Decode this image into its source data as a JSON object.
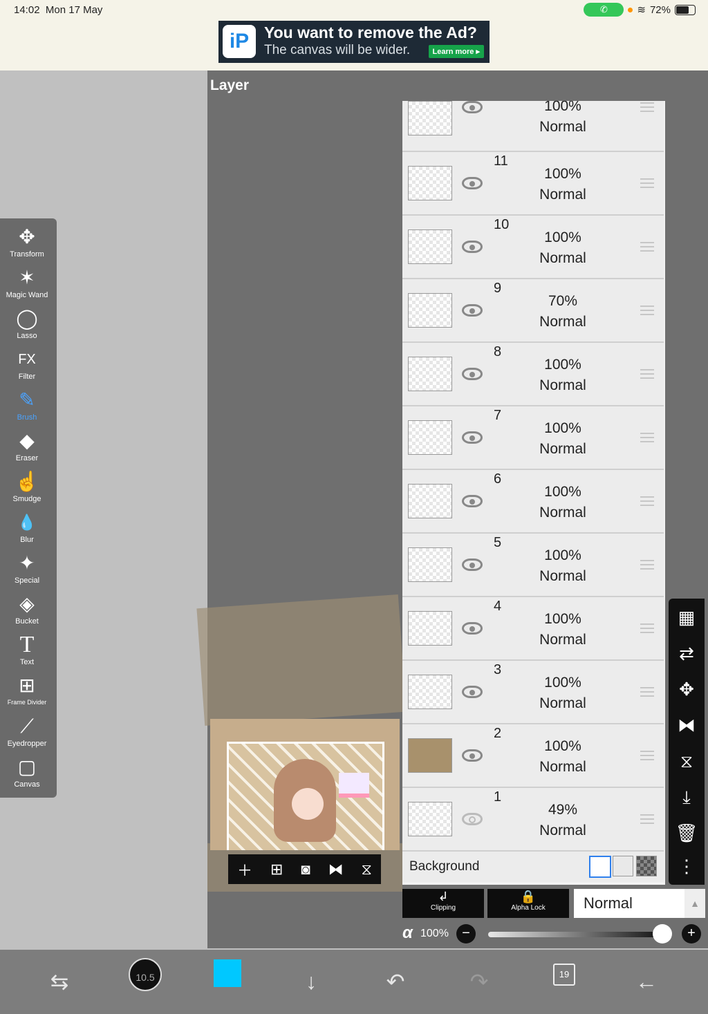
{
  "status": {
    "time": "14:02",
    "date": "Mon 17 May",
    "battery": "72%",
    "call_icon": "phone-icon"
  },
  "ad": {
    "title": "You want to remove the Ad?",
    "subtitle": "The canvas will be wider.",
    "button": "Learn more ▸",
    "logo": "iP"
  },
  "panel": {
    "title": "Layer"
  },
  "tools": [
    {
      "label": "Transform",
      "icon": "✥"
    },
    {
      "label": "Magic Wand",
      "icon": "✶"
    },
    {
      "label": "Lasso",
      "icon": "◯"
    },
    {
      "label": "Filter",
      "icon": "FX"
    },
    {
      "label": "Brush",
      "icon": "✎"
    },
    {
      "label": "Eraser",
      "icon": "◆"
    },
    {
      "label": "Smudge",
      "icon": "☝"
    },
    {
      "label": "Blur",
      "icon": "💧"
    },
    {
      "label": "Special",
      "icon": "✦"
    },
    {
      "label": "Bucket",
      "icon": "◈"
    },
    {
      "label": "Text",
      "icon": "T"
    },
    {
      "label": "Frame Divider",
      "icon": "⊞"
    },
    {
      "label": "Eyedropper",
      "icon": "⟋"
    },
    {
      "label": "Canvas",
      "icon": "▢"
    }
  ],
  "active_tool": "Brush",
  "layers": [
    {
      "num": "",
      "opacity": "100%",
      "blend": "Normal",
      "visible": true
    },
    {
      "num": "11",
      "opacity": "100%",
      "blend": "Normal",
      "visible": true
    },
    {
      "num": "10",
      "opacity": "100%",
      "blend": "Normal",
      "visible": true
    },
    {
      "num": "9",
      "opacity": "70%",
      "blend": "Normal",
      "visible": true
    },
    {
      "num": "8",
      "opacity": "100%",
      "blend": "Normal",
      "visible": true
    },
    {
      "num": "7",
      "opacity": "100%",
      "blend": "Normal",
      "visible": true
    },
    {
      "num": "6",
      "opacity": "100%",
      "blend": "Normal",
      "visible": true
    },
    {
      "num": "5",
      "opacity": "100%",
      "blend": "Normal",
      "visible": true
    },
    {
      "num": "4",
      "opacity": "100%",
      "blend": "Normal",
      "visible": true
    },
    {
      "num": "3",
      "opacity": "100%",
      "blend": "Normal",
      "visible": true
    },
    {
      "num": "2",
      "opacity": "100%",
      "blend": "Normal",
      "visible": true
    },
    {
      "num": "1",
      "opacity": "49%",
      "blend": "Normal",
      "visible": false
    }
  ],
  "background_row": {
    "label": "Background"
  },
  "right_tools": [
    "checker-icon",
    "swap-icon",
    "move-icon",
    "flip-horizontal-icon",
    "flip-vertical-icon",
    "merge-down-icon",
    "trash-icon",
    "more-icon"
  ],
  "blend_controls": {
    "clipping": "Clipping",
    "alpha_lock": "Alpha Lock",
    "mode": "Normal"
  },
  "alpha": {
    "symbol": "α",
    "value": "100%",
    "level": 1.0
  },
  "bottom": {
    "brush_size": "10.5",
    "color": "#00c8ff",
    "page_count": "19"
  }
}
